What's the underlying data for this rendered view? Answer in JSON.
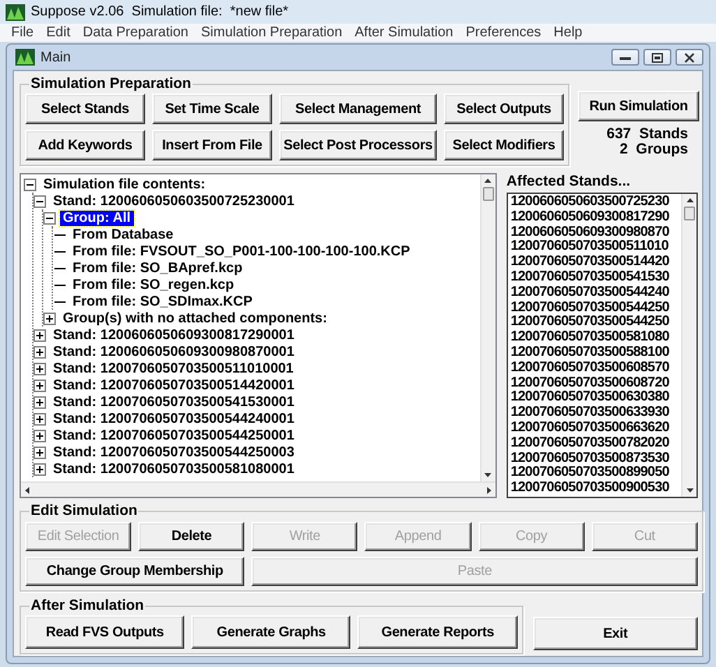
{
  "app_title": "Suppose v2.06  Simulation file:  *new file*",
  "menu": [
    "File",
    "Edit",
    "Data Preparation",
    "Simulation Preparation",
    "After Simulation",
    "Preferences",
    "Help"
  ],
  "window": {
    "title": "Main"
  },
  "simulation_preparation": {
    "title": "Simulation Preparation",
    "buttons": [
      "Select Stands",
      "Set Time Scale",
      "Select Management",
      "Select Outputs",
      "Add Keywords",
      "Insert From File",
      "Select Post Processors",
      "Select Modifiers"
    ],
    "run_button": "Run Simulation",
    "stand_count": "637  Stands",
    "group_count": "2  Groups"
  },
  "tree": [
    {
      "label": "Simulation file contents:",
      "expanded": true,
      "selected": false,
      "children": [
        {
          "label": "Stand: 1200606050603500725230001",
          "expanded": true,
          "selected": false,
          "children": [
            {
              "label": "Group: All",
              "expanded": true,
              "selected": true,
              "children": [
                {
                  "label": "From Database",
                  "selected": false
                },
                {
                  "label": "From file: FVSOUT_SO_P001-100-100-100-100.KCP",
                  "selected": false
                },
                {
                  "label": "From file: SO_BApref.kcp",
                  "selected": false
                },
                {
                  "label": "From file: SO_regen.kcp",
                  "selected": false
                },
                {
                  "label": "From file: SO_SDImax.KCP",
                  "selected": false
                }
              ]
            },
            {
              "label": "Group(s) with no attached components:",
              "expanded": false,
              "selected": false
            }
          ]
        },
        {
          "label": "Stand: 1200606050609300817290001",
          "expanded": false,
          "selected": false
        },
        {
          "label": "Stand: 1200606050609300980870001",
          "expanded": false,
          "selected": false
        },
        {
          "label": "Stand: 1200706050703500511010001",
          "expanded": false,
          "selected": false
        },
        {
          "label": "Stand: 1200706050703500514420001",
          "expanded": false,
          "selected": false
        },
        {
          "label": "Stand: 1200706050703500541530001",
          "expanded": false,
          "selected": false
        },
        {
          "label": "Stand: 1200706050703500544240001",
          "expanded": false,
          "selected": false
        },
        {
          "label": "Stand: 1200706050703500544250001",
          "expanded": false,
          "selected": false
        },
        {
          "label": "Stand: 1200706050703500544250003",
          "expanded": false,
          "selected": false
        },
        {
          "label": "Stand: 1200706050703500581080001",
          "expanded": false,
          "selected": false
        }
      ]
    }
  ],
  "affected_stands": {
    "title": "Affected Stands...",
    "items": [
      "1200606050603500725230",
      "1200606050609300817290",
      "1200606050609300980870",
      "1200706050703500511010",
      "1200706050703500514420",
      "1200706050703500541530",
      "1200706050703500544240",
      "1200706050703500544250",
      "1200706050703500544250",
      "1200706050703500581080",
      "1200706050703500588100",
      "1200706050703500608570",
      "1200706050703500608720",
      "1200706050703500630380",
      "1200706050703500633930",
      "1200706050703500663620",
      "1200706050703500782020",
      "1200706050703500873530",
      "1200706050703500899050",
      "1200706050703500900530"
    ]
  },
  "edit_simulation": {
    "title": "Edit Simulation",
    "buttons": [
      {
        "label": "Edit Selection",
        "disabled": true
      },
      {
        "label": "Delete",
        "disabled": false
      },
      {
        "label": "Write",
        "disabled": true
      },
      {
        "label": "Append",
        "disabled": true
      },
      {
        "label": "Copy",
        "disabled": true
      },
      {
        "label": "Cut",
        "disabled": true
      },
      {
        "label": "Change Group Membership",
        "disabled": false
      },
      {
        "label": "Paste",
        "disabled": true
      }
    ]
  },
  "after_simulation": {
    "title": "After Simulation",
    "buttons": [
      "Read FVS Outputs",
      "Generate Graphs",
      "Generate Reports"
    ]
  },
  "exit_button": "Exit"
}
